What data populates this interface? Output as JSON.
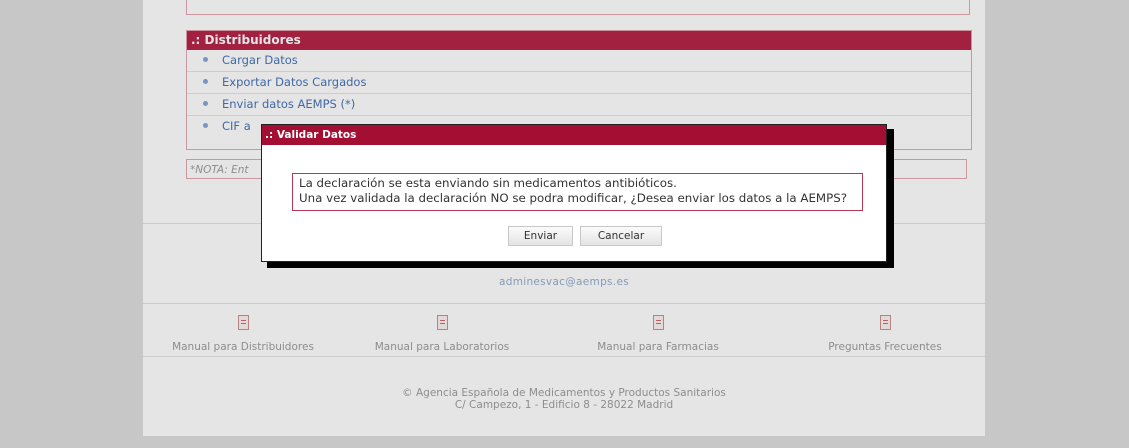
{
  "distribuidores": {
    "header": ".: Distribuidores",
    "items": [
      {
        "label": "Cargar Datos"
      },
      {
        "label": "Exportar Datos Cargados"
      },
      {
        "label": "Enviar datos AEMPS (*)"
      },
      {
        "label": "CIF a"
      }
    ]
  },
  "nota": "*NOTA: Ent",
  "contact_email": "adminesvac@aemps.es",
  "manuals": [
    {
      "label": "Manual para Distribuidores",
      "icon": "pdf-icon"
    },
    {
      "label": "Manual para Laboratorios",
      "icon": "pdf-icon"
    },
    {
      "label": "Manual para Farmacias",
      "icon": "pdf-icon"
    },
    {
      "label": "Preguntas Frecuentes",
      "icon": "pdf-icon"
    }
  ],
  "footer": {
    "line1": "© Agencia Española de Medicamentos y Productos Sanitarios",
    "line2": "C/ Campezo, 1 - Edificio 8 - 28022 Madrid"
  },
  "dialog": {
    "title": ".: Validar Datos",
    "message_line1": "La declaración se esta enviando sin medicamentos antibióticos.",
    "message_line2": "Una vez validada la declaración NO se podra modificar, ¿Desea enviar los datos a la AEMPS?",
    "send_label": "Enviar",
    "cancel_label": "Cancelar"
  },
  "colors": {
    "header_red": "#b21b3f",
    "dialog_title_red": "#a50e33",
    "link_blue": "#3f6fb4",
    "page_background": "#dcdcdc"
  }
}
